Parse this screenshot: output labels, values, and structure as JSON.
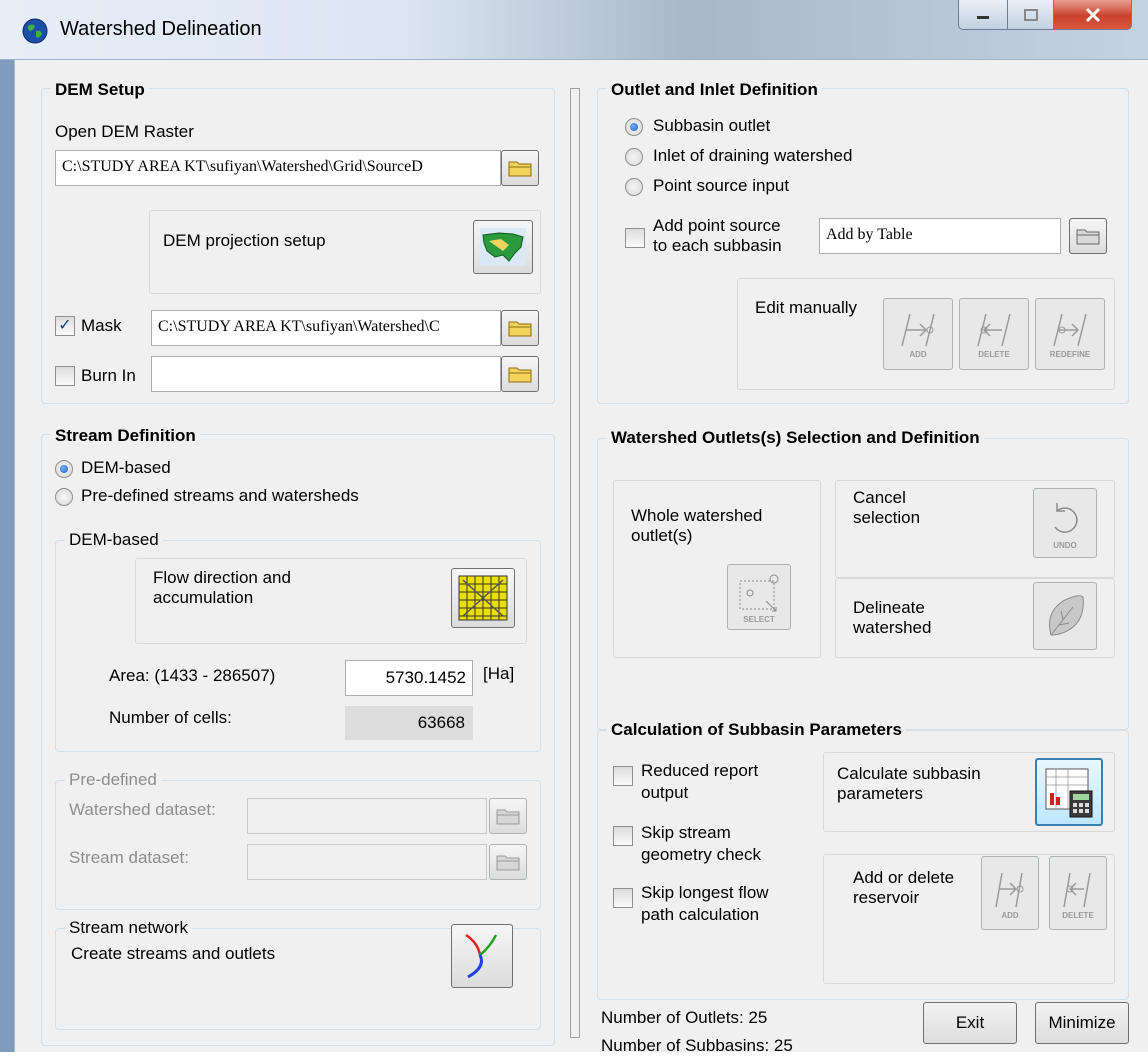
{
  "window": {
    "title": "Watershed Delineation"
  },
  "dem_setup": {
    "title": "DEM Setup",
    "open_dem_label": "Open DEM Raster",
    "dem_path": "C:\\STUDY AREA KT\\sufiyan\\Watershed\\Grid\\SourceD",
    "projection_label": "DEM projection setup",
    "mask_label": "Mask",
    "mask_checked": "✓",
    "mask_path": "C:\\STUDY AREA KT\\sufiyan\\Watershed\\C",
    "burn_in_label": "Burn In",
    "burn_in_path": ""
  },
  "stream_definition": {
    "title": "Stream Definition",
    "option_dem": "DEM-based",
    "option_predefined": "Pre-defined streams and watersheds",
    "dem_based_title": "DEM-based",
    "flow_label": "Flow direction and\naccumulation",
    "area_label": "Area: (1433 - 286507)",
    "area_value": "5730.1452",
    "area_unit": "[Ha]",
    "cells_label": "Number of cells:",
    "cells_value": "63668",
    "predefined_title": "Pre-defined",
    "watershed_dataset_label": "Watershed dataset:",
    "stream_dataset_label": "Stream dataset:",
    "network_title": "Stream network",
    "network_label": "Create streams and outlets"
  },
  "outlet_inlet": {
    "title": "Outlet and Inlet Definition",
    "option_subbasin": "Subbasin outlet",
    "option_inlet": "Inlet of draining watershed",
    "option_point": "Point source input",
    "add_point_label": "Add point source\nto each subbasin",
    "add_by_table": "Add by Table",
    "edit_manually": "Edit manually",
    "btn_add": "ADD",
    "btn_delete": "DELETE",
    "btn_redefine": "REDEFINE"
  },
  "watershed_outlets": {
    "title": "Watershed Outlets(s) Selection and Definition",
    "whole_label": "Whole watershed\noutlet(s)",
    "btn_select": "SELECT",
    "cancel_label": "Cancel\nselection",
    "btn_undo": "UNDO",
    "delineate_label": "Delineate\nwatershed"
  },
  "subbasin_params": {
    "title": "Calculation of Subbasin Parameters",
    "reduced_label": "Reduced  report\noutput",
    "skip_stream_label": "Skip stream\ngeometry check",
    "skip_longest_label": "Skip longest flow\npath calculation",
    "calculate_label": "Calculate subbasin\nparameters",
    "reservoir_label": "Add or delete\nreservoir",
    "btn_add": "ADD",
    "btn_delete": "DELETE"
  },
  "footer": {
    "outlets": "Number of Outlets: 25",
    "subbasins": "Number of Subbasins: 25",
    "exit": "Exit",
    "minimize": "Minimize"
  },
  "colors": {
    "group_border": "#d5dfe5",
    "radio_dot": "#1e5bb5",
    "stream_red": "#e02020",
    "stream_green": "#20a020",
    "stream_blue": "#2040e0"
  }
}
